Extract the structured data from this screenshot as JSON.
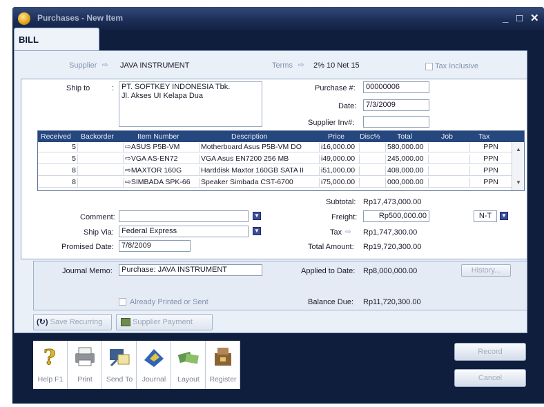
{
  "window": {
    "title": "Purchases - New Item"
  },
  "tab": {
    "label": "BILL"
  },
  "header": {
    "supplier_label": "Supplier",
    "supplier_value": "JAVA INSTRUMENT",
    "terms_label": "Terms",
    "terms_value": "2% 10 Net 15",
    "tax_inclusive_label": "Tax Inclusive"
  },
  "shipping": {
    "ship_to_label": "Ship to",
    "ship_to_line1": "PT. SOFTKEY INDONESIA Tbk.",
    "ship_to_line2": "Jl. Akses UI Kelapa Dua",
    "purchase_no_label": "Purchase #:",
    "purchase_no": "00000006",
    "date_label": "Date:",
    "date": "7/3/2009",
    "supplier_inv_label": "Supplier Inv#:",
    "supplier_inv": ""
  },
  "grid": {
    "columns": [
      "Received",
      "Backorder",
      "Item Number",
      "Description",
      "Price",
      "Disc%",
      "Total",
      "Job",
      "Tax"
    ],
    "rows": [
      {
        "received": "5",
        "backorder": "",
        "item": "ASUS P5B-VM",
        "description": "Motherboard Asus P5B-VM DO",
        "price": "i16,000.00",
        "disc": "",
        "total": "580,000.00",
        "job": "",
        "tax": "PPN"
      },
      {
        "received": "5",
        "backorder": "",
        "item": "VGA AS-EN72",
        "description": "VGA Asus EN7200 256 MB",
        "price": "i49,000.00",
        "disc": "",
        "total": "245,000.00",
        "job": "",
        "tax": "PPN"
      },
      {
        "received": "8",
        "backorder": "",
        "item": "MAXTOR 160G",
        "description": "Harddisk Maxtor 160GB SATA II",
        "price": "i51,000.00",
        "disc": "",
        "total": "408,000.00",
        "job": "",
        "tax": "PPN"
      },
      {
        "received": "8",
        "backorder": "",
        "item": "SIMBADA SPK-66",
        "description": "Speaker Simbada CST-6700",
        "price": "i75,000.00",
        "disc": "",
        "total": "000,000.00",
        "job": "",
        "tax": "PPN"
      }
    ]
  },
  "details": {
    "comment_label": "Comment:",
    "comment": "",
    "ship_via_label": "Ship Via:",
    "ship_via": "Federal Express",
    "promised_date_label": "Promised Date:",
    "promised_date": "7/8/2009"
  },
  "totals": {
    "subtotal_label": "Subtotal:",
    "subtotal": "Rp17,473,000.00",
    "freight_label": "Freight:",
    "freight": "Rp500,000.00",
    "freight_tax": "N-T",
    "tax_label": "Tax",
    "tax": "Rp1,747,300.00",
    "total_amount_label": "Total Amount:",
    "total_amount": "Rp19,720,300.00"
  },
  "journal": {
    "memo_label": "Journal Memo:",
    "memo": "Purchase: JAVA INSTRUMENT",
    "applied_label": "Applied to Date:",
    "applied": "Rp8,000,000.00",
    "history_label": "History...",
    "already_printed_label": "Already Printed or Sent",
    "balance_label": "Balance Due:",
    "balance": "Rp11,720,300.00"
  },
  "actions": {
    "save_recurring": "Save Recurring",
    "supplier_payment": "Supplier Payment",
    "record": "Record",
    "cancel": "Cancel"
  },
  "toolbar": [
    {
      "label": "Help F1",
      "icon": "help-icon"
    },
    {
      "label": "Print",
      "icon": "printer-icon"
    },
    {
      "label": "Send To",
      "icon": "send-to-icon"
    },
    {
      "label": "Journal",
      "icon": "journal-icon"
    },
    {
      "label": "Layout",
      "icon": "layout-icon"
    },
    {
      "label": "Register",
      "icon": "register-icon"
    }
  ]
}
